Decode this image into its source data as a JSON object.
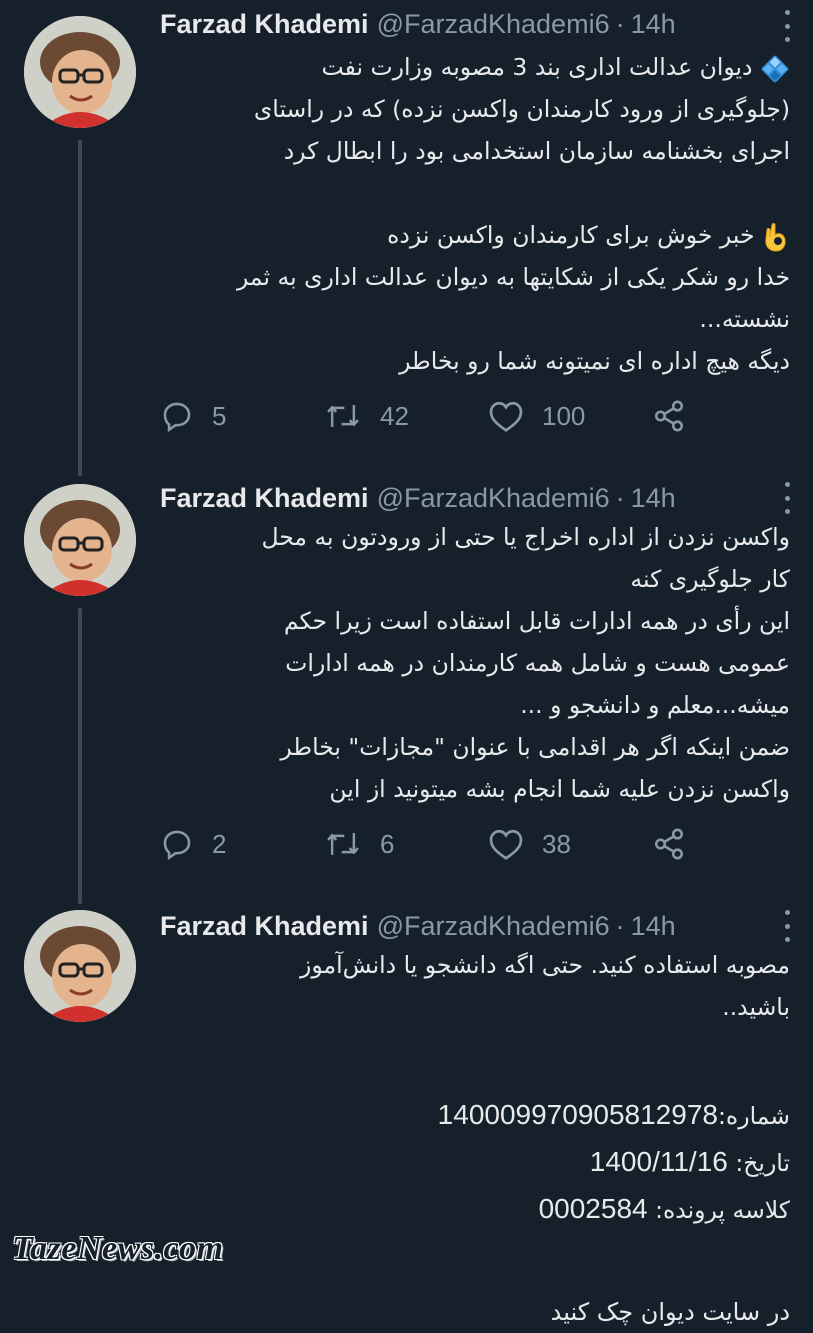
{
  "author": {
    "name": "Farzad Khademi",
    "handle": "@FarzadKhademi6",
    "separator": "·",
    "time": "14h"
  },
  "tweets": [
    {
      "lines": [
        "دیوان عدالت اداری بند 3 مصوبه وزارت نفت",
        "(جلوگیری از ورود کارمندان واکسن نزده) که در راستای",
        "اجرای بخشنامه سازمان استخدامی بود را ابطال کرد",
        "",
        "خبر خوش برای کارمندان واکسن نزده",
        "خدا رو شکر یکی از شکایتها به دیوان عدالت اداری به ثمر",
        "نشسته...",
        "دیگه هیچ اداره ای نمیتونه شما رو بخاطر"
      ],
      "replies": "5",
      "retweets": "42",
      "likes": "100"
    },
    {
      "lines": [
        "واکسن نزدن از اداره اخراج یا حتی از ورودتون به محل",
        "کار جلوگیری کنه",
        "این رأی در همه ادارات قابل استفاده است زیرا حکم",
        "عمومی هست و شامل همه کارمندان در همه ادارات",
        "میشه...معلم و دانشجو و ...",
        "ضمن اینکه اگر هر اقدامی با عنوان \"مجازات\" بخاطر",
        "واکسن نزدن علیه شما انجام بشه میتونید از این"
      ],
      "replies": "2",
      "retweets": "6",
      "likes": "38"
    },
    {
      "lines": [
        "مصوبه استفاده کنید. حتی اگه دانشجو یا دانش‌آموز",
        "باشید..",
        "",
        ""
      ],
      "fields": [
        {
          "label": "شماره:",
          "value": "140009970905812978"
        },
        {
          "label": "تاریخ: ",
          "value": "1400/11/16"
        },
        {
          "label": "کلاسه پرونده: ",
          "value": "0002584"
        }
      ],
      "footer": "در سایت دیوان چک کنید"
    }
  ],
  "icons": {
    "bullet": "blue-diamond-icon",
    "emoji": "ok-hand-icon",
    "reply": "reply-icon",
    "retweet": "retweet-icon",
    "like": "heart-icon",
    "share": "share-icon",
    "more": "more-vertical-icon"
  },
  "colors": {
    "background": "#15202b",
    "text": "#e7e9ea",
    "muted": "#8b98a5",
    "thread_line": "#3e4a56"
  },
  "watermark": "TazeNews.com"
}
